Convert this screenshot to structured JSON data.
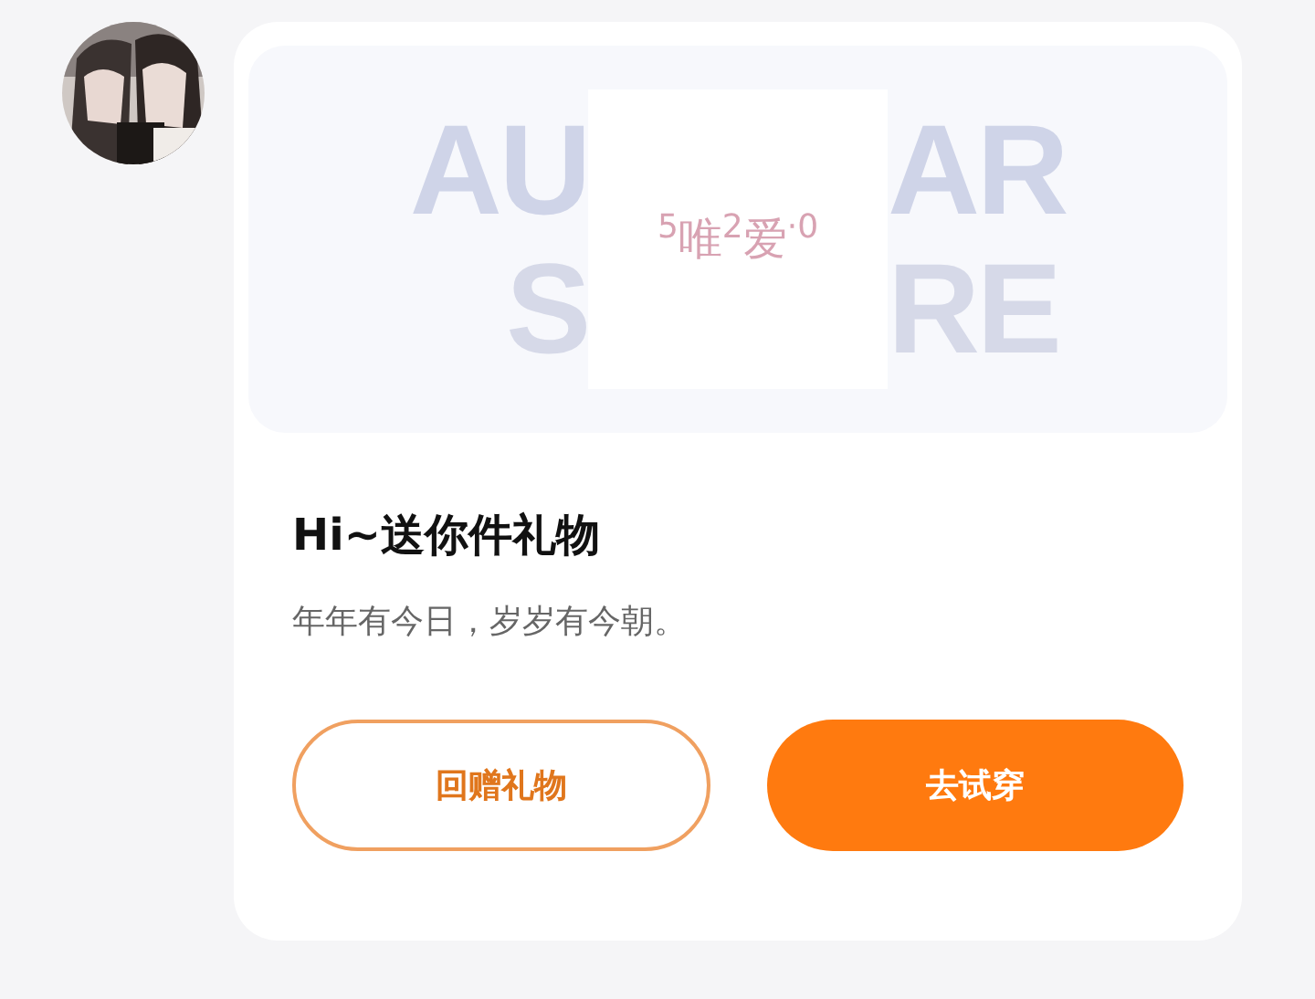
{
  "banner": {
    "background_fragments": [
      {
        "left": "AU",
        "right": "AR"
      },
      {
        "left": "S",
        "right": "RE"
      }
    ],
    "gift_logo": "$^{5}$唯$^{2}$爱$^{·0}$"
  },
  "title": "Hi~送你件礼物",
  "message": "年年有今日，岁岁有今朝。",
  "buttons": [
    {
      "label": "回赠礼物",
      "kind": "outline"
    },
    {
      "label": "去试穿",
      "kind": "primary"
    }
  ]
}
